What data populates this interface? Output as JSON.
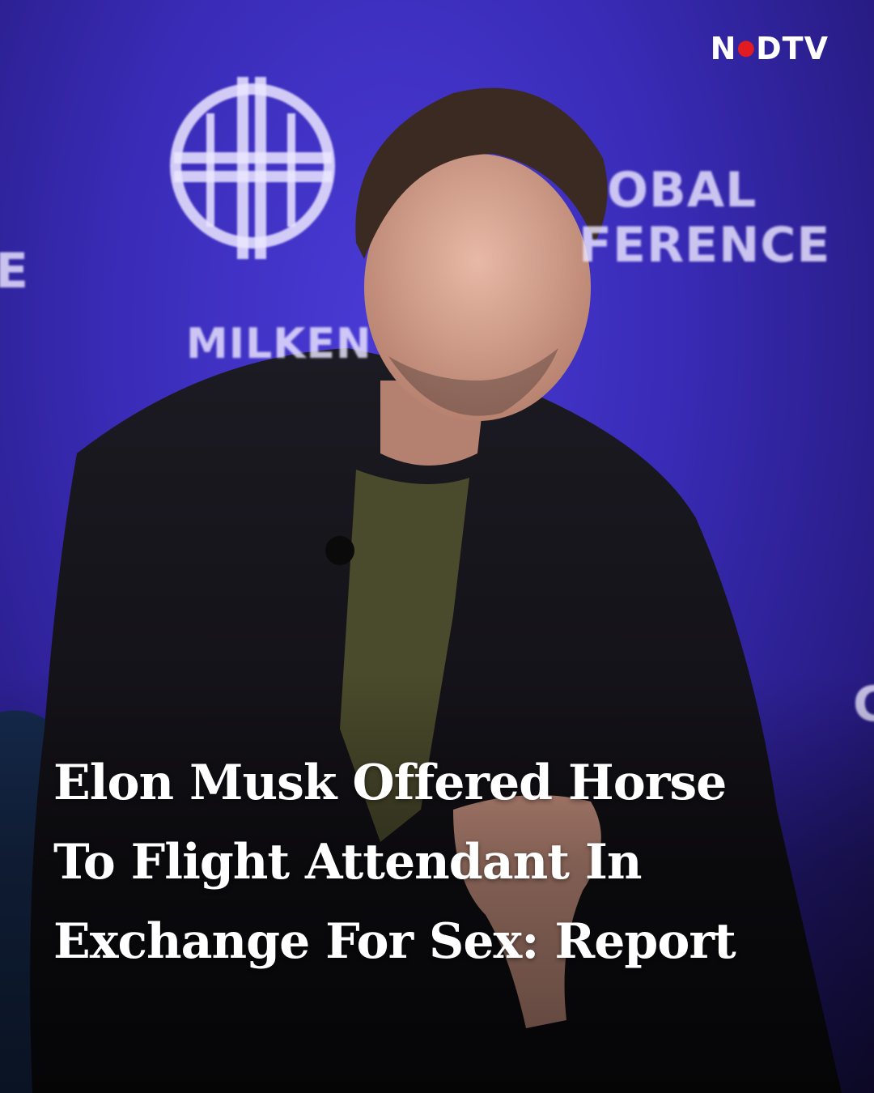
{
  "brand": {
    "name": "NDTV",
    "name_pre": "N",
    "name_post": "DTV"
  },
  "photo": {
    "backdrop_text": [
      "MILKEN",
      "OBAL",
      "FERENCE",
      "E",
      "C"
    ]
  },
  "headline": {
    "lines": [
      "Elon Musk Offered Horse",
      "To Flight Attendant In",
      "Exchange For Sex: Report"
    ]
  },
  "colors": {
    "backdrop": "#3a2cb8",
    "logo_dot": "#e01b22",
    "text": "#ffffff"
  }
}
